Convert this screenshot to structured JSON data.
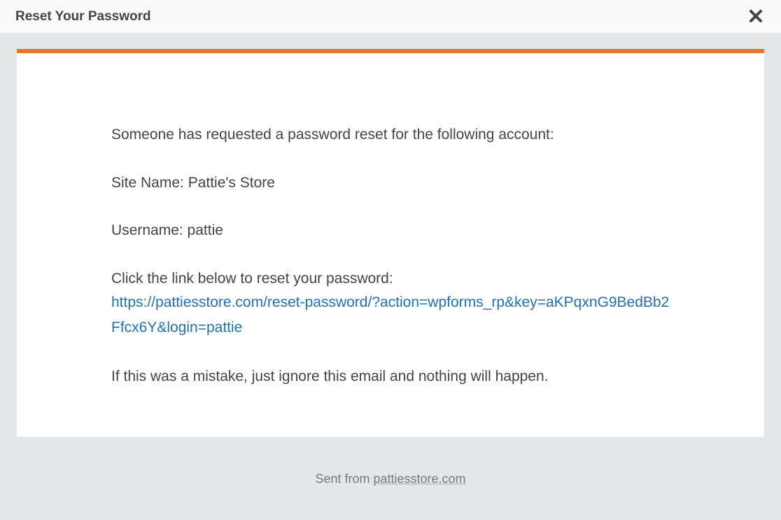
{
  "modal": {
    "title": "Reset Your Password"
  },
  "email": {
    "intro": "Someone has requested a password reset for the following account:",
    "site_line": "Site Name: Pattie's Store",
    "username_line": "Username: pattie",
    "instruction": "Click the link below to reset your password:",
    "reset_url": "https://pattiesstore.com/reset-password/?action=wpforms_rp&key=aKPqxnG9BedBb2Ffcx6Y&login=pattie",
    "mistake": "If this was a mistake, just ignore this email and nothing will happen."
  },
  "footer": {
    "sent_from_prefix": "Sent from ",
    "domain": "pattiesstore.com"
  },
  "colors": {
    "accent": "#e27730",
    "link": "#2271b1"
  }
}
